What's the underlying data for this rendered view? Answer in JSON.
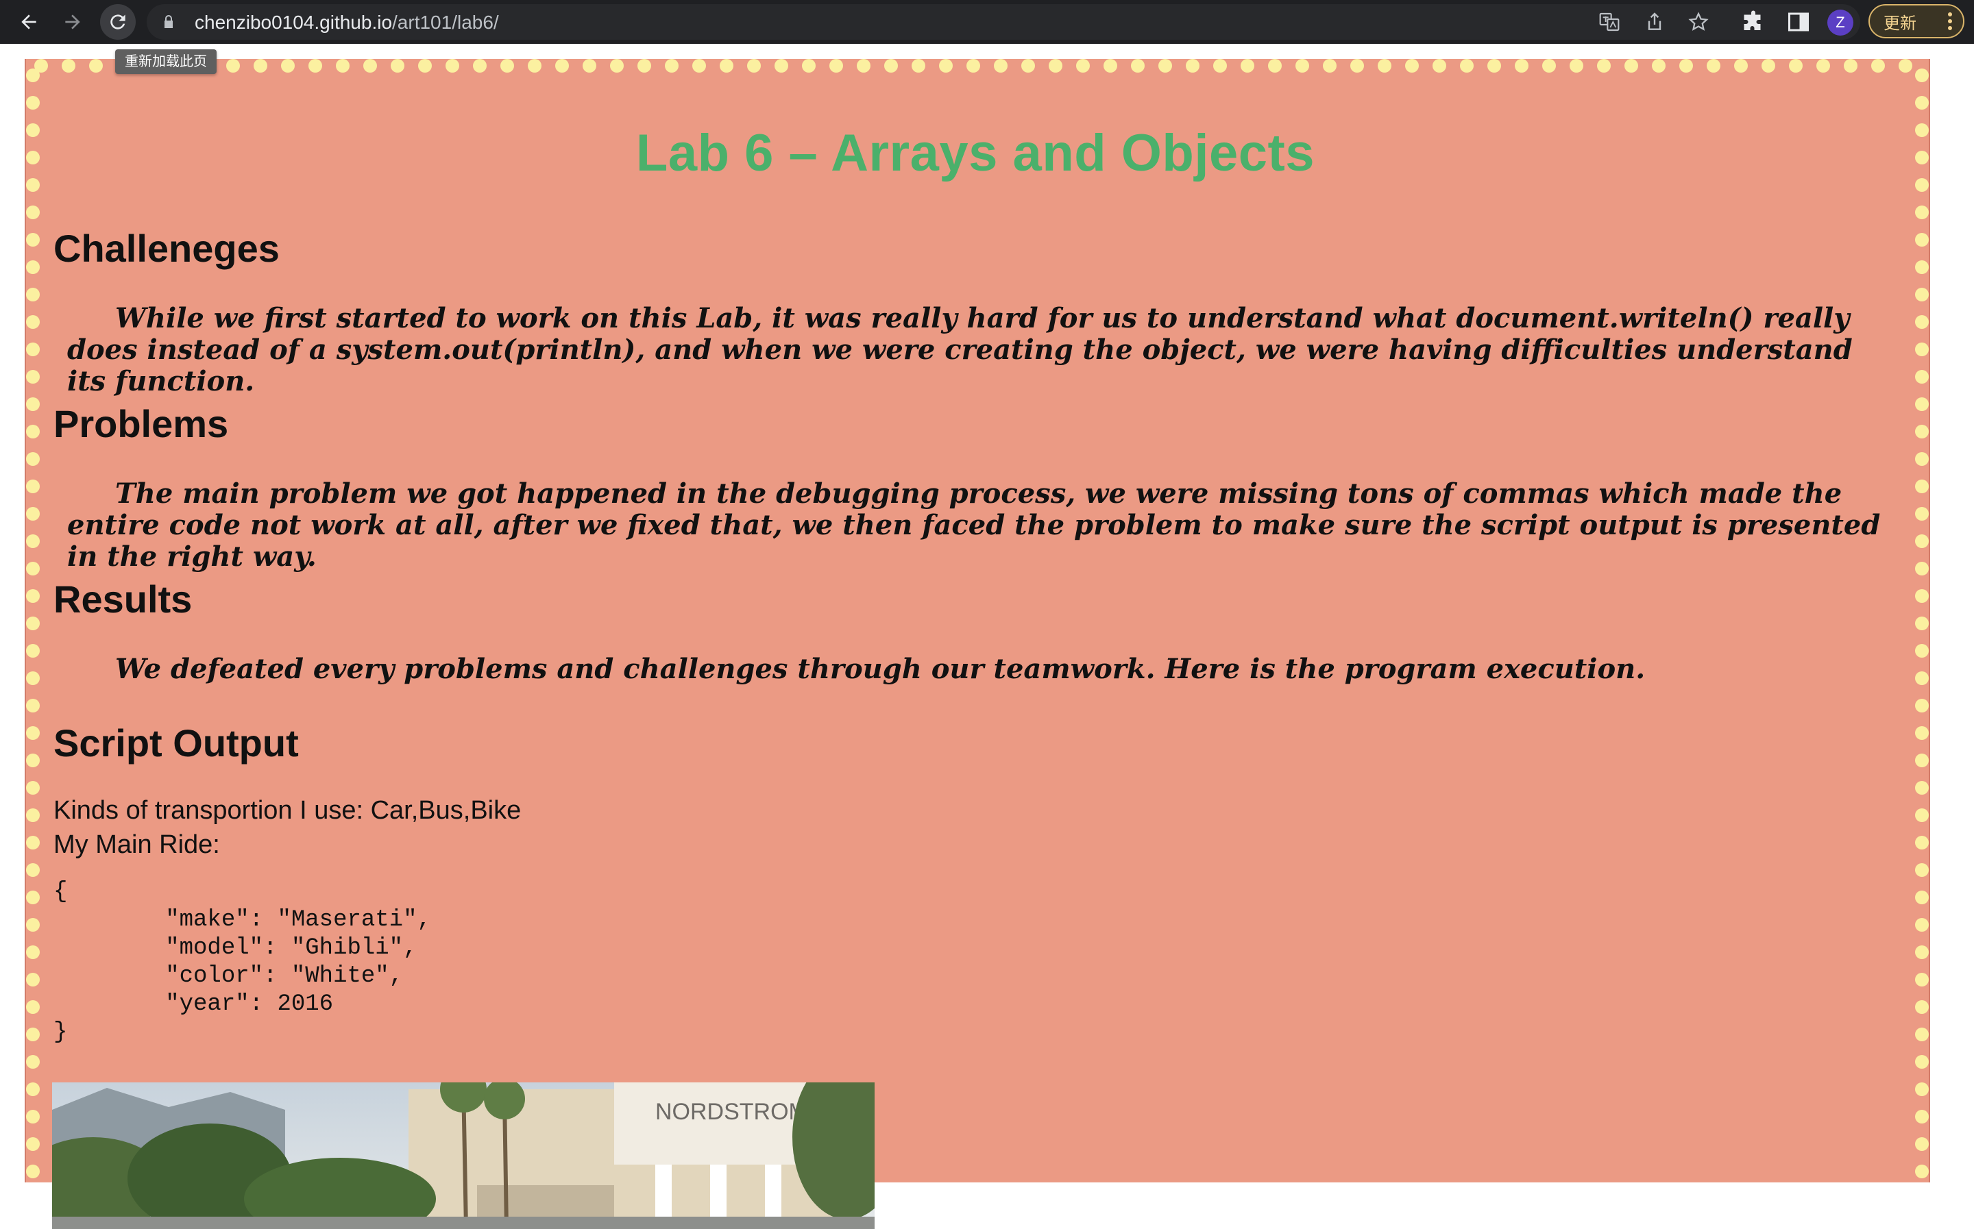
{
  "browser": {
    "url_host": "chenzibo0104.github.io",
    "url_path": "/art101/lab6/",
    "tooltip": "重新加载此页",
    "profile_initial": "Z",
    "update_label": "更新"
  },
  "page": {
    "title": "Lab 6 – Arrays and Objects",
    "sections": [
      {
        "heading": "Challeneges",
        "text": "While we first started to work on this Lab, it was really hard for us to understand what document.writeln() really does instead of a system.out(println), and when we were creating the object, we were having difficulties understand its function."
      },
      {
        "heading": "Problems",
        "text": "The main problem we got happened in the debugging process, we were missing tons of commas which made the entire code not work at all, after we fixed that, we then faced the problem to make sure the script output is presented in the right way."
      },
      {
        "heading": "Results",
        "text": "We defeated every problems and challenges through our teamwork. Here is the program execution."
      }
    ],
    "output": {
      "heading": "Script Output",
      "transport_line": "Kinds of transportion I use: Car,Bus,Bike",
      "ride_label": "My Main Ride:",
      "json_text": "{\n        \"make\": \"Maserati\",\n        \"model\": \"Ghibli\",\n        \"color\": \"White\",\n        \"year\": 2016\n}",
      "photo_sign": "NORDSTROM"
    }
  },
  "colors": {
    "page_bg": "#eb9a84",
    "title": "#4bb06b",
    "dots": "#fbf0a0"
  }
}
